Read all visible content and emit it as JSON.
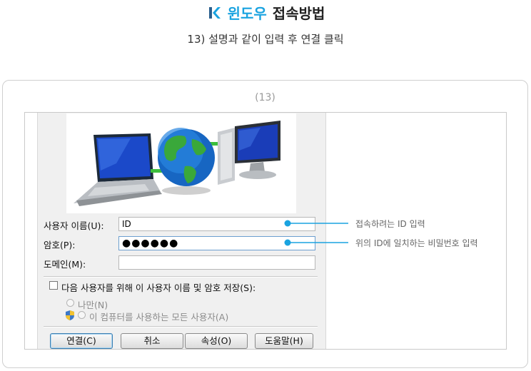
{
  "header": {
    "title_accent": "윈도우",
    "title_main": "접속방법",
    "subtitle": "13) 설명과 같이 입력 후 연결 클릭"
  },
  "step_label": "(13)",
  "dialog": {
    "labels": {
      "username": "사용자 이름(U):",
      "password": "암호(P):",
      "domain": "도메인(M):"
    },
    "fields": {
      "username_value": "ID",
      "password_value": "●●●●●●",
      "domain_value": ""
    },
    "save_checkbox": "다음 사용자를 위해 이 사용자 이름 및 암호 저장(S):",
    "radio_me_only": "나만(N)",
    "radio_everyone": "이 컴퓨터를 사용하는 모든 사용자(A)",
    "buttons": {
      "connect": "연결(C)",
      "cancel": "취소",
      "properties": "속성(O)",
      "help": "도움말(H)"
    }
  },
  "callouts": {
    "id": "접속하려는 ID 입력",
    "pw": "위의 ID에 일치하는 비밀번호 입력"
  },
  "colors": {
    "accent": "#1aa3e0",
    "callout_line": "#1aa3e0"
  },
  "icons": [
    "logo-icon",
    "network-illustration",
    "shield-icon"
  ]
}
